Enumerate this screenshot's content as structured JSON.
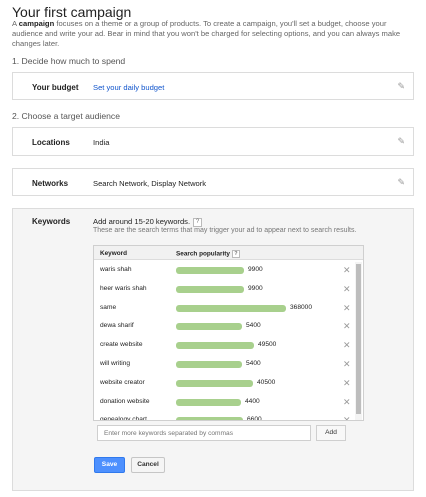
{
  "title": "Your first campaign",
  "intro": {
    "bold": "campaign",
    "prefix": "A ",
    "text": " focuses on a theme or a group of products. To create a campaign, you'll set a budget, choose your audience and write your ad. Bear in mind that you won't be charged for selecting options, and you can always make changes later."
  },
  "steps": {
    "one": "1. Decide how much to spend",
    "two": "2. Choose a target audience"
  },
  "budget": {
    "label": "Your budget",
    "value": "Set your daily budget"
  },
  "locations": {
    "label": "Locations",
    "value": "India"
  },
  "networks": {
    "label": "Networks",
    "value": "Search Network, Display Network"
  },
  "keywords": {
    "label": "Keywords",
    "heading": "Add around 15-20 keywords.",
    "help": "?",
    "subheading": "These are the search terms that may trigger your ad to appear next to search results.",
    "col_keyword": "Keyword",
    "col_popularity": "Search popularity",
    "max_value": 368000,
    "rows": [
      {
        "keyword": "waris shah",
        "popularity": 9900
      },
      {
        "keyword": "heer waris shah",
        "popularity": 9900
      },
      {
        "keyword": "same",
        "popularity": 368000
      },
      {
        "keyword": "dewa sharif",
        "popularity": 5400
      },
      {
        "keyword": "create website",
        "popularity": 49500
      },
      {
        "keyword": "will writing",
        "popularity": 5400
      },
      {
        "keyword": "website creator",
        "popularity": 40500
      },
      {
        "keyword": "donation website",
        "popularity": 4400
      },
      {
        "keyword": "genealogy chart",
        "popularity": 6600
      }
    ],
    "input_placeholder": "Enter more keywords separated by commas",
    "add_label": "Add"
  },
  "actions": {
    "save": "Save",
    "cancel": "Cancel"
  },
  "colors": {
    "bar": "#a8d08d",
    "link": "#1155cc",
    "primary": "#4d90fe"
  },
  "icons": {
    "edit": "pencil-icon",
    "remove": "close-icon",
    "help": "help-icon"
  }
}
